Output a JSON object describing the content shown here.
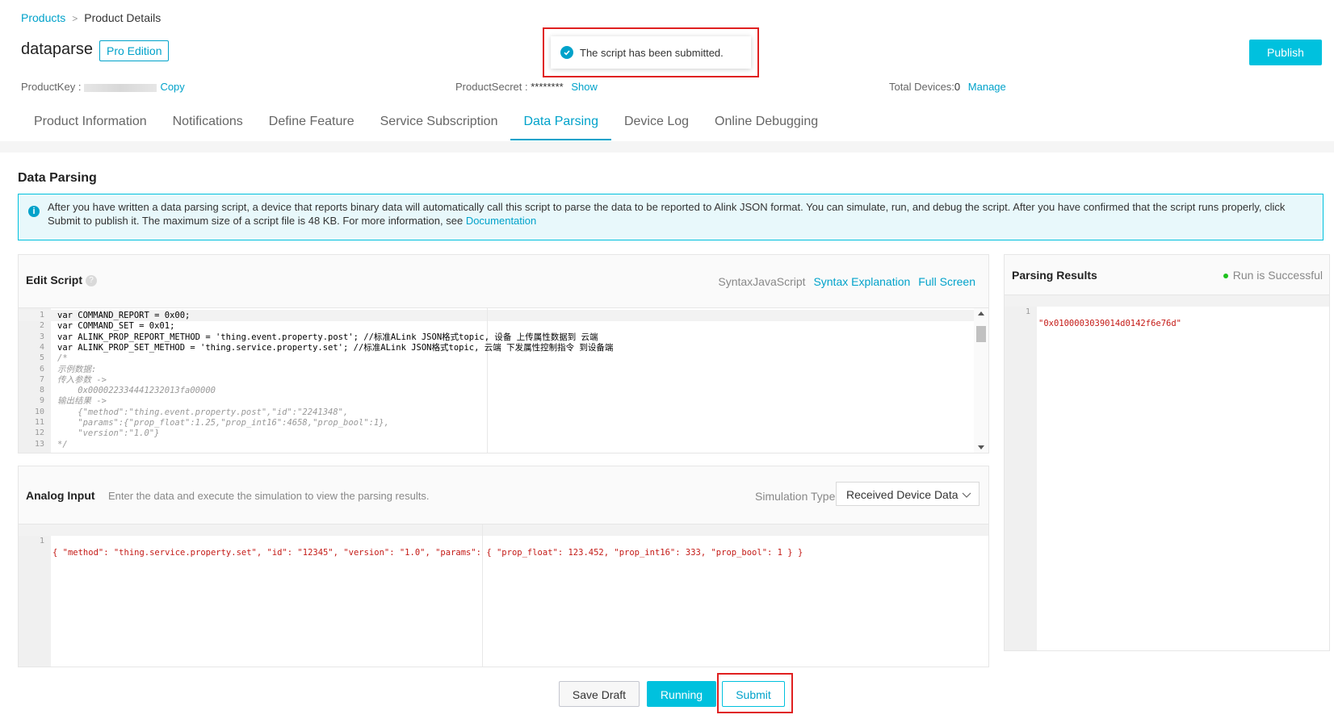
{
  "breadcrumb": {
    "root": "Products",
    "current": "Product Details"
  },
  "product": {
    "name": "dataparse",
    "edition": "Pro Edition",
    "product_key_label": "ProductKey :",
    "copy_label": "Copy",
    "product_secret_label": "ProductSecret :",
    "product_secret_value": "********",
    "show_label": "Show",
    "total_devices_label": "Total Devices:",
    "total_devices_value": "0",
    "manage_label": "Manage"
  },
  "header": {
    "publish_label": "Publish"
  },
  "toast": {
    "message": "The script has been submitted."
  },
  "tabs": [
    {
      "label": "Product Information"
    },
    {
      "label": "Notifications"
    },
    {
      "label": "Define Feature"
    },
    {
      "label": "Service Subscription"
    },
    {
      "label": "Data Parsing",
      "active": true
    },
    {
      "label": "Device Log"
    },
    {
      "label": "Online Debugging"
    }
  ],
  "section": {
    "title": "Data Parsing",
    "info_text": "After you have written a data parsing script, a device that reports binary data will automatically call this script to parse the data to be reported to Alink JSON format. You can simulate, run, and debug the script. After you have confirmed that the script runs properly, click Submit to publish it. The maximum size of a script file is 48 KB. For more information, see",
    "info_link": "Documentation"
  },
  "edit_script": {
    "title": "Edit Script",
    "syntax_label": "SyntaxJavaScript",
    "syntax_explanation": "Syntax Explanation",
    "full_screen": "Full Screen",
    "lines": [
      {
        "n": "1",
        "text": "var COMMAND_REPORT = 0x00;"
      },
      {
        "n": "2",
        "text": "var COMMAND_SET = 0x01;"
      },
      {
        "n": "3",
        "text": "var ALINK_PROP_REPORT_METHOD = 'thing.event.property.post'; //标准ALink JSON格式topic, 设备 上传属性数据到 云端"
      },
      {
        "n": "4",
        "text": "var ALINK_PROP_SET_METHOD = 'thing.service.property.set'; //标准ALink JSON格式topic, 云端 下发属性控制指令 到设备端"
      },
      {
        "n": "5",
        "text": "/*"
      },
      {
        "n": "6",
        "text": "示例数据:"
      },
      {
        "n": "7",
        "text": "传入参数 ->"
      },
      {
        "n": "8",
        "text": "    0x000022334441232013fa00000"
      },
      {
        "n": "9",
        "text": "输出结果 ->"
      },
      {
        "n": "10",
        "text": "    {\"method\":\"thing.event.property.post\",\"id\":\"2241348\","
      },
      {
        "n": "11",
        "text": "    \"params\":{\"prop_float\":1.25,\"prop_int16\":4658,\"prop_bool\":1},"
      },
      {
        "n": "12",
        "text": "    \"version\":\"1.0\"}"
      },
      {
        "n": "13",
        "text": "*/"
      }
    ]
  },
  "analog_input": {
    "title": "Analog Input",
    "hint": "Enter the data and execute the simulation to view the parsing results.",
    "simulation_type_label": "Simulation Type",
    "simulation_type_value": "Received Device Data",
    "line_number": "1",
    "code": "{ \"method\": \"thing.service.property.set\", \"id\": \"12345\", \"version\": \"1.0\", \"params\": { \"prop_float\": 123.452, \"prop_int16\": 333, \"prop_bool\": 1 } }"
  },
  "parsing_results": {
    "title": "Parsing Results",
    "status": "Run is Successful",
    "line_number": "1",
    "value": "\"0x0100003039014d0142f6e76d\""
  },
  "actions": {
    "save_draft": "Save Draft",
    "running": "Running",
    "submit": "Submit"
  },
  "colors": {
    "accent": "#00a2ca",
    "primary_button": "#00c1de",
    "highlight_frame": "#e02020",
    "success": "#1dc11d"
  }
}
